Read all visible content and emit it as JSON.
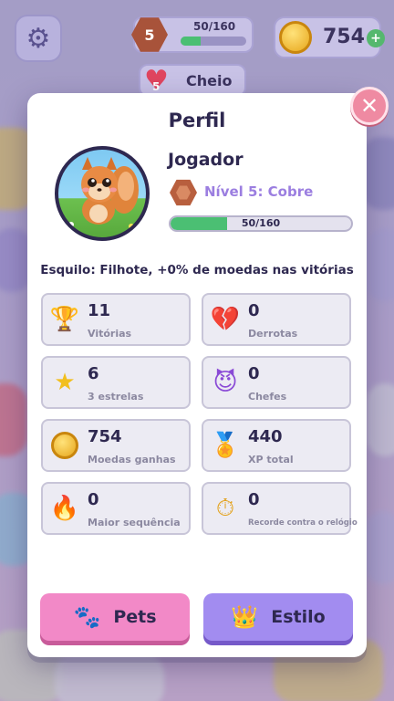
{
  "hud": {
    "level_number": "5",
    "xp_text": "50/160",
    "xp_progress": 0.31,
    "coins": "754",
    "coins_plus": "+",
    "hearts_count": "5",
    "hearts_status": "Cheio",
    "settings_icon": "gear-icon"
  },
  "modal": {
    "title": "Perfil",
    "close_symbol": "✕",
    "player_name": "Jogador",
    "rank": "Nível 5: Cobre",
    "xp_text": "50/160",
    "xp_progress": 0.3125,
    "species_text": "Esquilo: Filhote, +0% de moedas nas vitórias",
    "stats": [
      {
        "icon": "trophy-icon",
        "value": "11",
        "label": "Vitórias"
      },
      {
        "icon": "broken-heart-icon",
        "value": "0",
        "label": "Derrotas"
      },
      {
        "icon": "star-icon",
        "value": "6",
        "label": "3 estrelas"
      },
      {
        "icon": "devil-icon",
        "value": "0",
        "label": "Chefes"
      },
      {
        "icon": "coin-icon",
        "value": "754",
        "label": "Moedas ganhas"
      },
      {
        "icon": "medal-icon",
        "value": "440",
        "label": "XP total"
      },
      {
        "icon": "fire-icon",
        "value": "0",
        "label": "Maior sequência"
      },
      {
        "icon": "stopwatch-icon",
        "value": "0",
        "label": "Recorde contra o relógio"
      }
    ],
    "pets_button": "Pets",
    "style_button": "Estilo"
  },
  "colors": {
    "accent_pink": "#f289c7",
    "accent_purple": "#a28cf0",
    "xp_green": "#4bbf73",
    "rank_copper": "#b85f3e",
    "text_dark": "#2e2850"
  }
}
